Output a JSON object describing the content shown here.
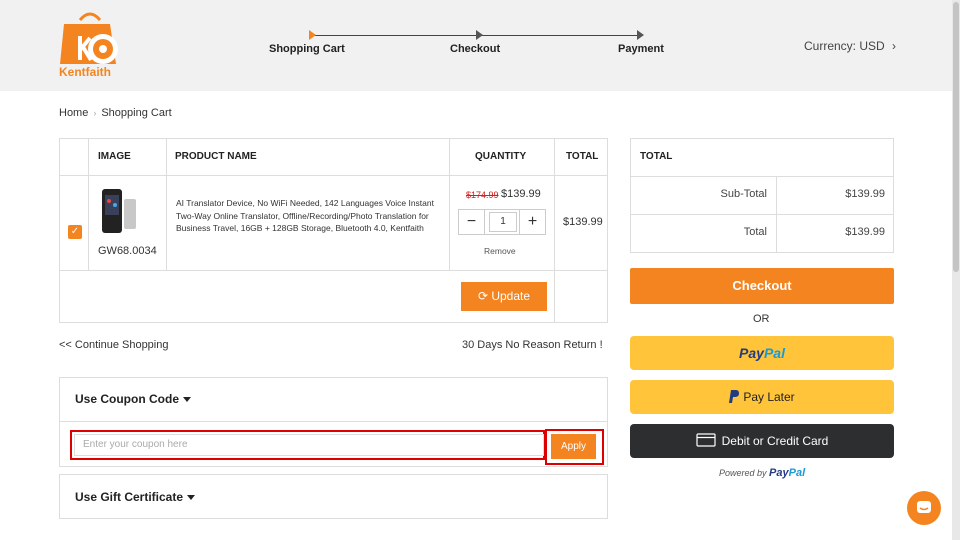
{
  "brand": {
    "name": "Kentfaith",
    "color": "#f4841f"
  },
  "steps": [
    "Shopping Cart",
    "Checkout",
    "Payment"
  ],
  "currency": "Currency: USD",
  "breadcrumb": [
    "Home",
    "Shopping Cart"
  ],
  "cart": {
    "headers": [
      "IMAGE",
      "PRODUCT NAME",
      "QUANTITY",
      "TOTAL"
    ],
    "item": {
      "sku": "GW68.0034",
      "name": "AI Translator Device, No WiFi Needed, 142 Languages Voice Instant Two-Way Online Translator, Offline/Recording/Photo Translation for Business Travel, 16GB + 128GB Storage, Bluetooth 4.0, Kentfaith",
      "old_price": "$174.99",
      "price": "$139.99",
      "quantity": "1",
      "remove": "Remove",
      "total": "$139.99",
      "checked": true
    },
    "update": "Update"
  },
  "continue_shopping": "<< Continue Shopping",
  "return_policy": "30 Days No Reason Return !",
  "coupon": {
    "title": "Use Coupon Code",
    "placeholder": "Enter your coupon here",
    "apply": "Apply"
  },
  "gift": {
    "title": "Use Gift Certificate"
  },
  "totals": {
    "header": "TOTAL",
    "rows": [
      {
        "label": "Sub-Total",
        "value": "$139.99"
      },
      {
        "label": "Total",
        "value": "$139.99"
      }
    ]
  },
  "checkout": "Checkout",
  "or": "OR",
  "paypal": {
    "pay": "Pay",
    "pal": "Pal",
    "pay_later": "Pay Later",
    "card": "Debit or Credit Card",
    "powered_by": "Powered by"
  }
}
